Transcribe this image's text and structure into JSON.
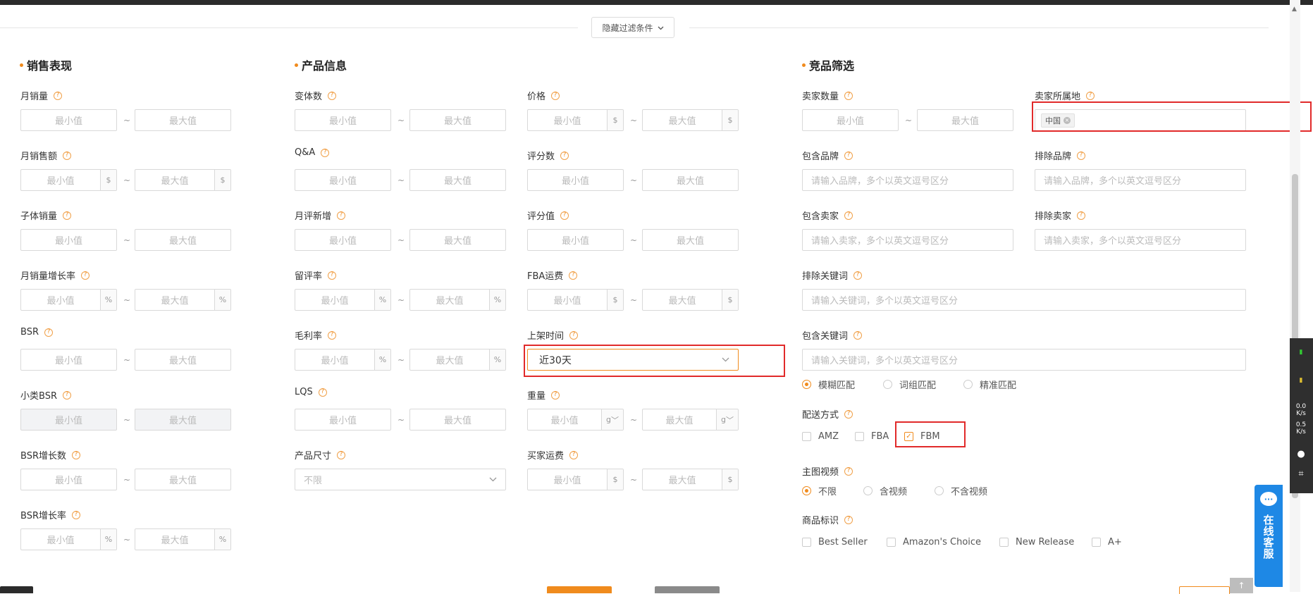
{
  "filter_toggle": {
    "label": "隐藏过滤条件"
  },
  "placeholders": {
    "min": "最小值",
    "max": "最大值",
    "tilde": "~"
  },
  "units": {
    "dollar": "$",
    "percent": "%",
    "gram": "g"
  },
  "sections": {
    "sales": "销售表现",
    "product": "产品信息",
    "competitor": "竞品筛选"
  },
  "sales": {
    "monthly_sales": "月销量",
    "monthly_revenue": "月销售额",
    "child_sales": "子体销量",
    "sales_growth": "月销量增长率",
    "bsr": "BSR",
    "sub_bsr": "小类BSR",
    "bsr_growth": "BSR增长数",
    "bsr_growth_rate": "BSR增长率"
  },
  "product": {
    "variants": "变体数",
    "qa": "Q&A",
    "monthly_new_reviews": "月评新增",
    "review_rate": "留评率",
    "gross_margin": "毛利率",
    "lqs": "LQS",
    "size": "产品尺寸",
    "size_value": "不限",
    "price": "价格",
    "rating_count": "评分数",
    "rating_value": "评分值",
    "fba_fee": "FBA运费",
    "listing_time": "上架时间",
    "listing_time_value": "近30天",
    "weight": "重量",
    "seller_shipping": "买家运费"
  },
  "competitor": {
    "seller_count": "卖家数量",
    "seller_location": "卖家所属地",
    "location_tag": "中国",
    "include_brand": "包含品牌",
    "exclude_brand": "排除品牌",
    "brand_placeholder": "请输入品牌，多个以英文逗号区分",
    "include_seller": "包含卖家",
    "exclude_seller": "排除卖家",
    "seller_placeholder": "请输入卖家，多个以英文逗号区分",
    "exclude_keywords": "排除关键词",
    "include_keywords": "包含关键词",
    "keyword_placeholder": "请输入关键词，多个以英文逗号区分",
    "match_options": [
      "模糊匹配",
      "词组匹配",
      "精准匹配"
    ],
    "match_selected": "模糊匹配",
    "delivery": "配送方式",
    "delivery_options": [
      "AMZ",
      "FBA",
      "FBM"
    ],
    "delivery_checked": "FBM",
    "video": "主图视频",
    "video_options": [
      "不限",
      "含视频",
      "不含视频"
    ],
    "video_selected": "不限",
    "badges": "商品标识",
    "badge_options": [
      "Best Seller",
      "Amazon's Choice",
      "New Release",
      "A+"
    ]
  },
  "side_panel": {
    "net_up": "0.0",
    "net_down": "0.5",
    "unit": "K/s"
  },
  "service": {
    "label": "在线客服"
  },
  "colors": {
    "accent": "#f08b1d",
    "highlight": "#e12a2a",
    "service": "#1e88e5"
  }
}
